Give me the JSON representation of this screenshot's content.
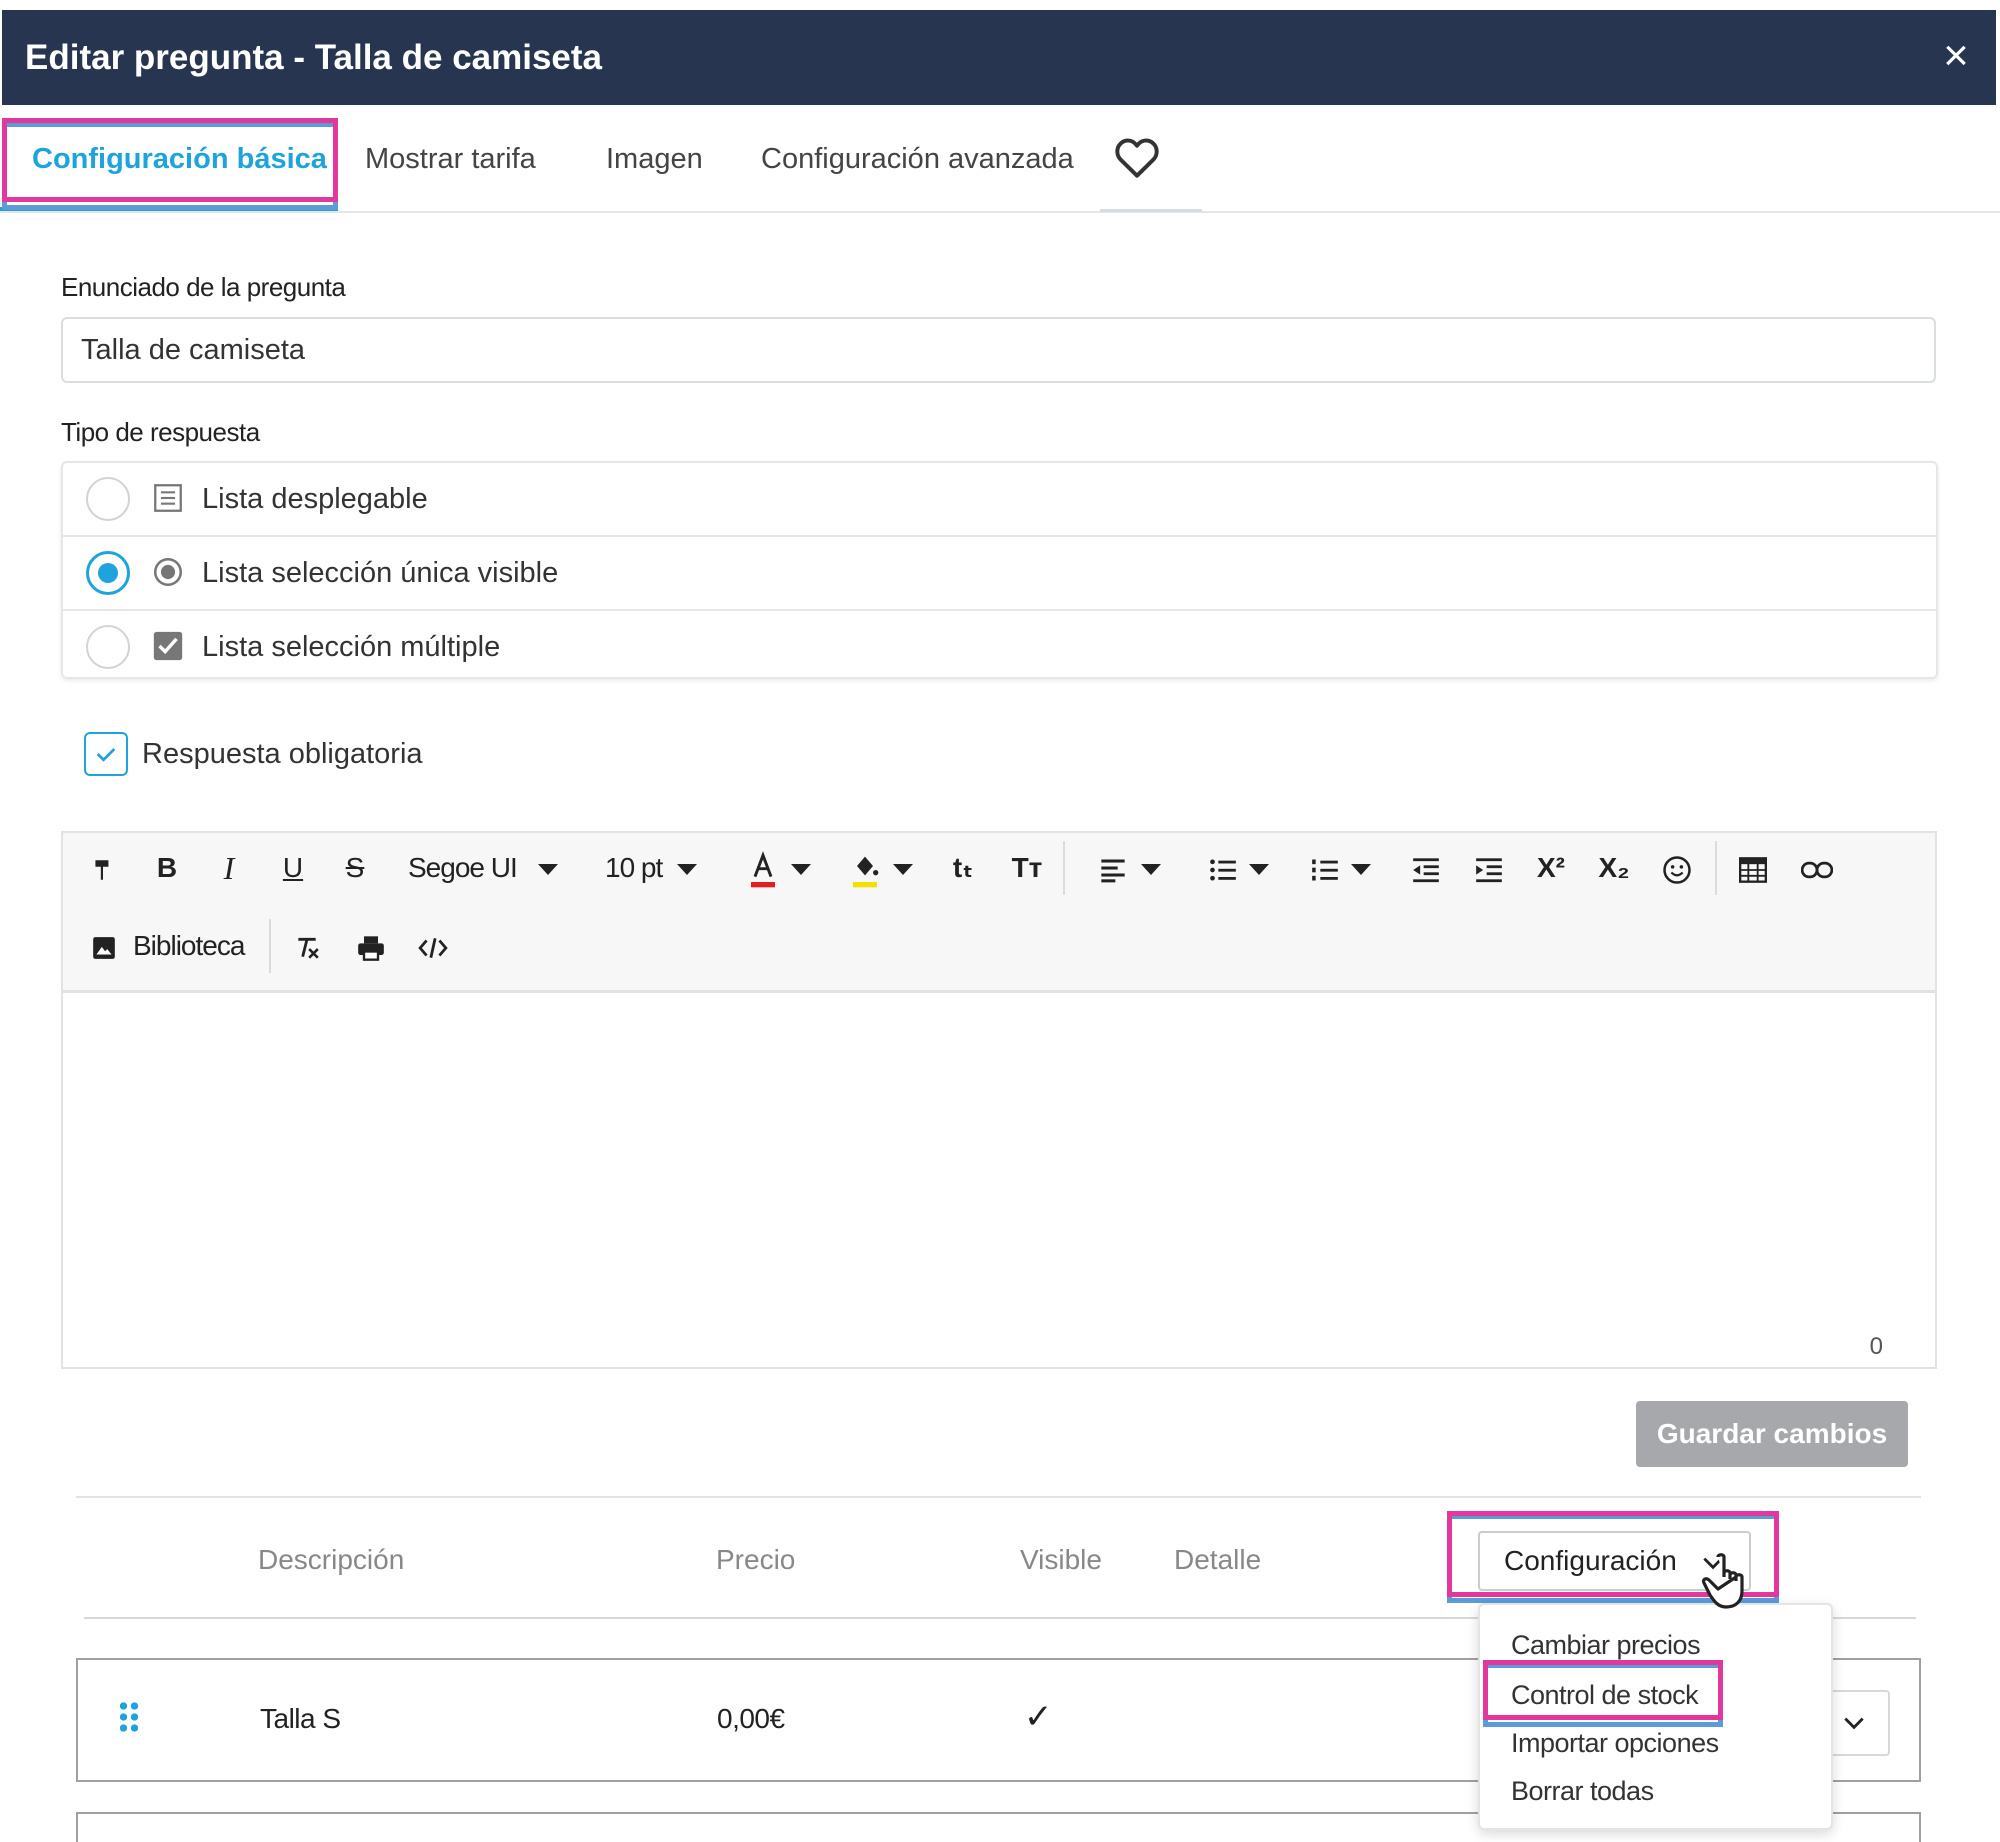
{
  "dialog": {
    "title": "Editar pregunta - Talla de camiseta",
    "close_symbol": "×"
  },
  "tabs": [
    {
      "label": "Configuración básica",
      "active": true
    },
    {
      "label": "Mostrar tarifa"
    },
    {
      "label": "Imagen"
    },
    {
      "label": "Configuración avanzada"
    }
  ],
  "favorite_icon": "heart-icon",
  "form": {
    "question_label": "Enunciado de la pregunta",
    "question_value": "Talla de camiseta",
    "answer_type_label": "Tipo de respuesta",
    "answer_types": [
      {
        "label": "Lista desplegable",
        "icon": "list-icon",
        "selected": false
      },
      {
        "label": "Lista selección única visible",
        "icon": "radio-icon",
        "selected": true
      },
      {
        "label": "Lista selección múltiple",
        "icon": "checkbox-icon",
        "selected": false
      }
    ],
    "required_label": "Respuesta obligatoria",
    "required_checked": true
  },
  "editor": {
    "font_family": "Segoe UI",
    "font_size": "10 pt",
    "library_label": "Biblioteca",
    "superscript": "X²",
    "subscript": "X₂",
    "char_count": "0"
  },
  "save_button": "Guardar cambios",
  "table": {
    "headers": [
      "Descripción",
      "Precio",
      "Visible",
      "Detalle"
    ],
    "rows": [
      {
        "description": "Talla S",
        "price": "0,00€",
        "visible": "✓"
      }
    ]
  },
  "config_menu": {
    "button_label": "Configuración",
    "items": [
      "Cambiar precios",
      "Control de stock",
      "Importar opciones",
      "Borrar todas"
    ],
    "highlighted": "Control de stock"
  },
  "colors": {
    "header_bg": "#273550",
    "accent": "#1fa3dc",
    "highlight_pink": "#e2389e",
    "highlight_blue": "#5b9bd8",
    "save_button_bg": "#a6a8ab"
  }
}
